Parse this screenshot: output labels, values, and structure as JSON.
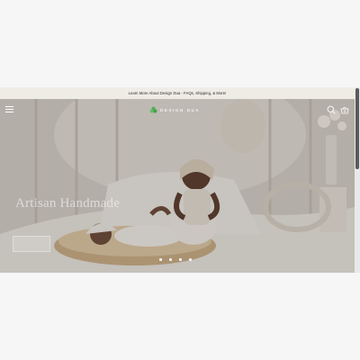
{
  "announcement": {
    "text": "Learn More About Design Dua - FAQs, Shipping, & More!"
  },
  "header": {
    "brand": "DESIGN DUA",
    "icons": {
      "menu": "hamburger-icon",
      "search": "search-icon",
      "cart": "cart-icon"
    }
  },
  "hero": {
    "title": "Artisan Handmade",
    "cta_label": "",
    "slides": 4,
    "active_slide": 1
  },
  "colors": {
    "announcement_bg": "#efece6",
    "logo_green": "#4caf50",
    "page_bg": "#f6f6f7"
  }
}
